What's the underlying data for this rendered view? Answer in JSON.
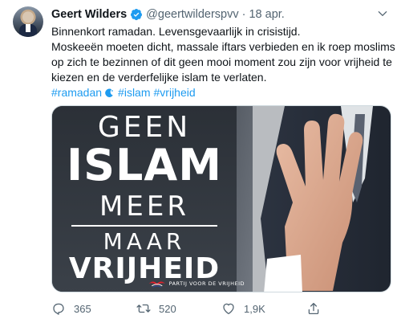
{
  "tweet": {
    "author_name": "Geert Wilders",
    "handle": "@geertwilderspvv",
    "separator": "·",
    "date": "18 apr.",
    "text_lines": [
      "Binnenkort ramadan. Levensgevaarlijk in crisistijd.",
      "Moskeeën moeten dicht, massale iftars verbieden en ik roep moslims op zich te bezinnen of dit geen mooi moment zou zijn voor vrijheid te kiezen en de verderfelijke islam te verlaten."
    ],
    "hashtags": [
      "#ramadan",
      "#islam",
      "#vrijheid"
    ]
  },
  "media": {
    "line1": "GEEN",
    "line2": "ISLAM",
    "line3": "MEER",
    "line4": "MAAR",
    "line5": "VRIJHEID",
    "logo_text": "PARTIJ VOOR DE VRIJHEID"
  },
  "actions": {
    "reply_count": "365",
    "retweet_count": "520",
    "like_count": "1,9K"
  },
  "icons": {
    "verified": "verified-badge-icon",
    "more": "chevron-down-icon",
    "reply": "reply-icon",
    "retweet": "retweet-icon",
    "like": "heart-icon",
    "share": "share-icon"
  },
  "colors": {
    "accent": "#1d9bf0",
    "secondary_text": "#536471"
  }
}
